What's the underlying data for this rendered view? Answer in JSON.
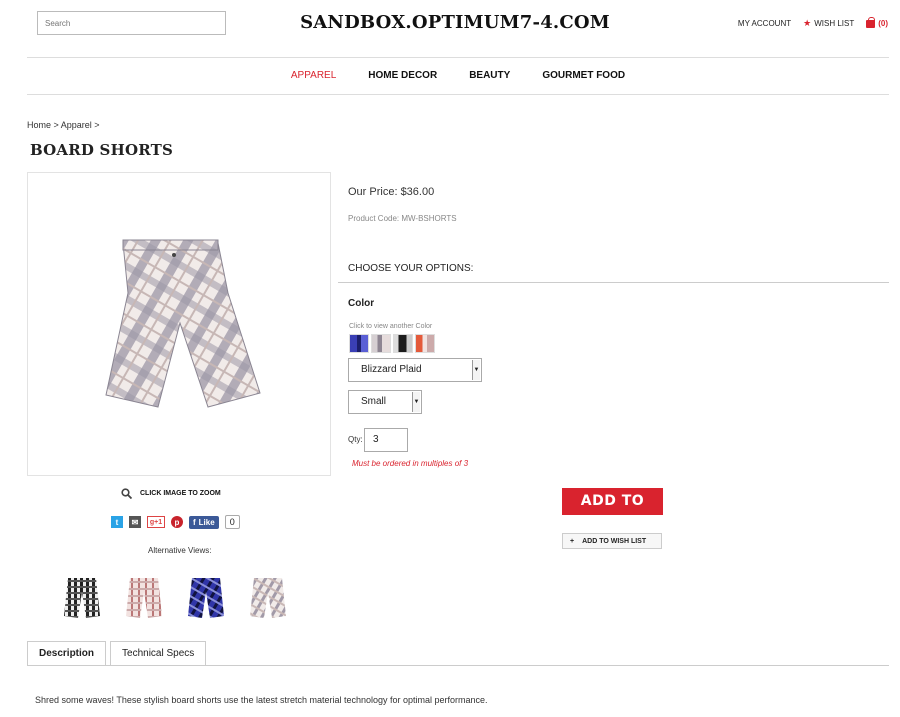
{
  "header": {
    "search_placeholder": "Search",
    "site_title": "SANDBOX.OPTIMUM7-4.COM",
    "my_account": "MY ACCOUNT",
    "wish_list": "WISH LIST",
    "bag_count": "(0)"
  },
  "nav": {
    "items": [
      "APPAREL",
      "HOME DECOR",
      "BEAUTY",
      "GOURMET FOOD"
    ],
    "active": "APPAREL"
  },
  "breadcrumb": "Home > Apparel >",
  "product": {
    "title": "BOARD SHORTS",
    "price": "Our Price: $36.00",
    "code": "Product Code: MW-BSHORTS",
    "options_heading": "CHOOSE YOUR OPTIONS:",
    "color_label": "Color",
    "color_hint": "Click to view another Color",
    "color_value": "Blizzard Plaid",
    "size_value": "Small",
    "qty_label": "Qty:",
    "qty_value": "3",
    "qty_note": "Must be ordered in multiples of 3",
    "add_to_bag": "ADD TO BAG",
    "add_to_wishlist": "ADD TO WISH LIST",
    "zoom_text": "CLICK IMAGE TO ZOOM",
    "alt_views_label": "Alternative Views:",
    "like_label": "Like",
    "like_count": "0",
    "gplus_label": "g+1"
  },
  "tabs": [
    "Description",
    "Technical Specs"
  ],
  "description": "Shred some waves! These stylish board shorts use the latest stretch material technology for optimal performance.",
  "colors": {
    "accent": "#d9232e",
    "swatches": [
      "#3a3fb5",
      "#b8aeb0",
      "#1c1c1c",
      "#d7c4c4"
    ]
  }
}
